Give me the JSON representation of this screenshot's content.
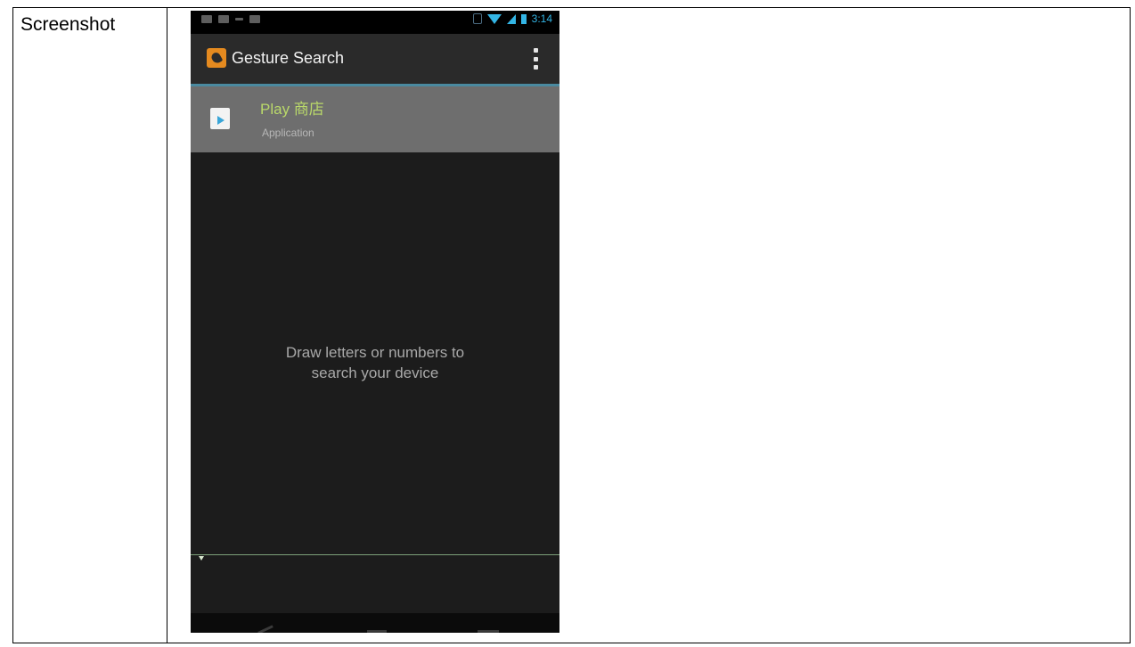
{
  "document": {
    "row_label": "Screenshot"
  },
  "status_bar": {
    "time": "3:14"
  },
  "app_bar": {
    "title": "Gesture Search",
    "icon": "gesture-search-app-icon",
    "overflow_icon": "overflow-menu-icon"
  },
  "results": [
    {
      "title": "Play 商店",
      "subtitle": "Application",
      "icon": "play-store-icon"
    }
  ],
  "hint": {
    "line1": "Draw letters or numbers to",
    "line2": "search your device"
  },
  "colors": {
    "accent_blue": "#33b5e5",
    "result_title": "#b9d86a",
    "background": "#1c1c1c"
  }
}
